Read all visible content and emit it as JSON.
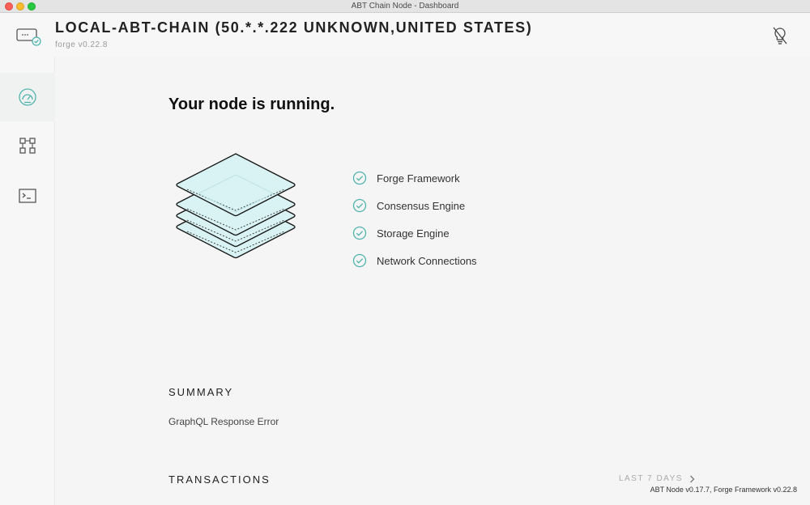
{
  "window": {
    "title": "ABT Chain Node - Dashboard"
  },
  "header": {
    "node_title": "LOCAL-ABT-CHAIN (50.*.*.222 UNKNOWN,UNITED STATES)",
    "subtitle": "forge v0.22.8"
  },
  "sidebar": {
    "items": [
      {
        "name": "dashboard",
        "icon": "speedometer-icon",
        "active": true
      },
      {
        "name": "apps",
        "icon": "grid-icon",
        "active": false
      },
      {
        "name": "console",
        "icon": "terminal-icon",
        "active": false
      }
    ]
  },
  "main": {
    "headline": "Your node is running.",
    "checks": [
      {
        "label": "Forge Framework",
        "status": "ok"
      },
      {
        "label": "Consensus Engine",
        "status": "ok"
      },
      {
        "label": "Storage Engine",
        "status": "ok"
      },
      {
        "label": "Network Connections",
        "status": "ok"
      }
    ],
    "summary": {
      "title": "SUMMARY",
      "text": "GraphQL Response Error"
    },
    "transactions": {
      "title": "TRANSACTIONS",
      "range_label": "LAST 7 DAYS"
    }
  },
  "footer": {
    "version": "ABT Node v0.17.7, Forge Framework v0.22.8"
  },
  "colors": {
    "accent": "#4fb3ad",
    "layer_fill": "#d9f3f4"
  }
}
